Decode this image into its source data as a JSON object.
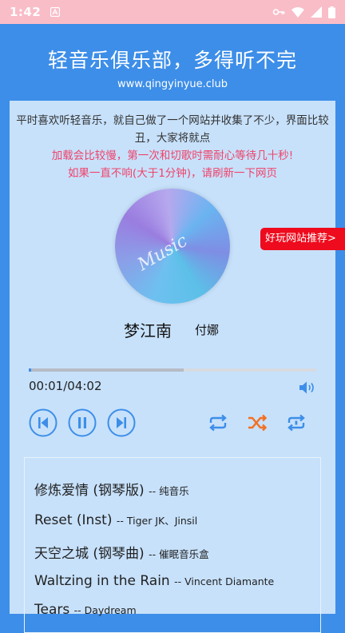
{
  "status_bar": {
    "time": "1:42",
    "icons": [
      "app-notification-icon",
      "vpn-key-icon",
      "wifi-icon",
      "cell-signal-icon",
      "battery-icon"
    ]
  },
  "header": {
    "title": "轻音乐俱乐部，多得听不完",
    "url": "www.qingyinyue.club"
  },
  "notice": {
    "line1": "平时喜欢听轻音乐，就自己做了一个网站并收集了不少，界面比较丑，大家将就点",
    "line2": "加载会比较慢，第一次和切歌时需耐心等待几十秒!",
    "line3": "如果一直不响(大于1分钟)，请刷新一下网页"
  },
  "player": {
    "cover_text": "Music",
    "song_title": "梦江南",
    "artist": "付娜",
    "time_display": "00:01/04:02",
    "progress": {
      "played_percent": 0.8,
      "buffered_percent": 54
    }
  },
  "promo_button": "好玩网站推荐>",
  "playlist": [
    {
      "title": "修炼爱情 (钢琴版)",
      "artist": "-- 纯音乐"
    },
    {
      "title": "Reset (Inst)",
      "artist": "-- Tiger JK、Jinsil"
    },
    {
      "title": "天空之城 (钢琴曲)",
      "artist": "-- 催眠音乐盒"
    },
    {
      "title": "Waltzing in the Rain",
      "artist": "-- Vincent Diamante"
    },
    {
      "title": "Tears",
      "artist": "-- Daydream"
    }
  ],
  "colors": {
    "background": "#3d8ee8",
    "panel": "#c7e1fb",
    "status_bar": "#f9bdc8",
    "warning_text": "#f0436a",
    "promo": "#ee0b1d",
    "accent_blue": "#3d8ee8",
    "shuffle_orange": "#f37021"
  }
}
